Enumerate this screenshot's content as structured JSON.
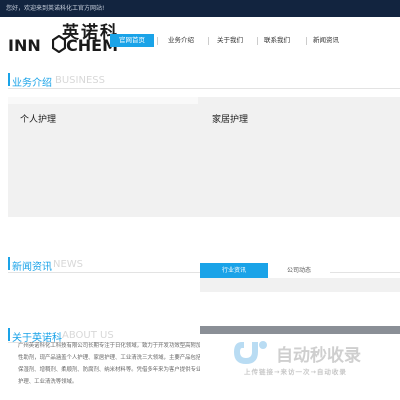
{
  "topbar": {
    "greeting": "您好，欢迎来到英诺科化工官方网站!"
  },
  "logo": {
    "cn": "英诺科",
    "en_left": "INN",
    "en_right": "CHEM"
  },
  "nav": {
    "items": [
      {
        "label": "官网首页",
        "active": true
      },
      {
        "label": "业务介绍",
        "active": false
      },
      {
        "label": "关于我们",
        "active": false
      },
      {
        "label": "联系我们",
        "active": false
      },
      {
        "label": "新闻资讯",
        "active": false
      }
    ]
  },
  "business": {
    "title_cn": "业务介绍",
    "title_en": "BUSINESS",
    "panels": [
      {
        "label": "个人护理"
      },
      {
        "label": "家居护理"
      }
    ]
  },
  "news": {
    "title_cn": "新闻资讯",
    "title_en": "NEWS",
    "tabs": [
      {
        "label": "行业资讯",
        "active": true
      },
      {
        "label": "公司动态",
        "active": false
      }
    ]
  },
  "about": {
    "title_cn": "关于英诺科",
    "title_en": "ABOUT US",
    "paragraph": [
      "广州英诺科化工科技有限公司长期专注于日化领域，致力于开发功效型高附加值功能",
      "性助剂，现产品涵盖个人护理、家居护理、工业清洗三大领域，主要产品包括消泡剂、抑菌剂、",
      "保湿剂、增稠剂、柔顺剂、防腐剂、纳米材料等。凭借多年来为客户提供专业的技术服务，",
      "护理、工业清洗等领域。"
    ],
    "paragraph_raw": "广州英诺科化工科技有限公司致力于开发功效型高附加值功能性助剂"
  },
  "watermark": {
    "main": "自动秒收录",
    "sub": "上传链接→来访一次→自动收录"
  },
  "colors": {
    "accent": "#1aa3e8",
    "topbar": "#12243f",
    "panel": "#f1f1f1"
  }
}
